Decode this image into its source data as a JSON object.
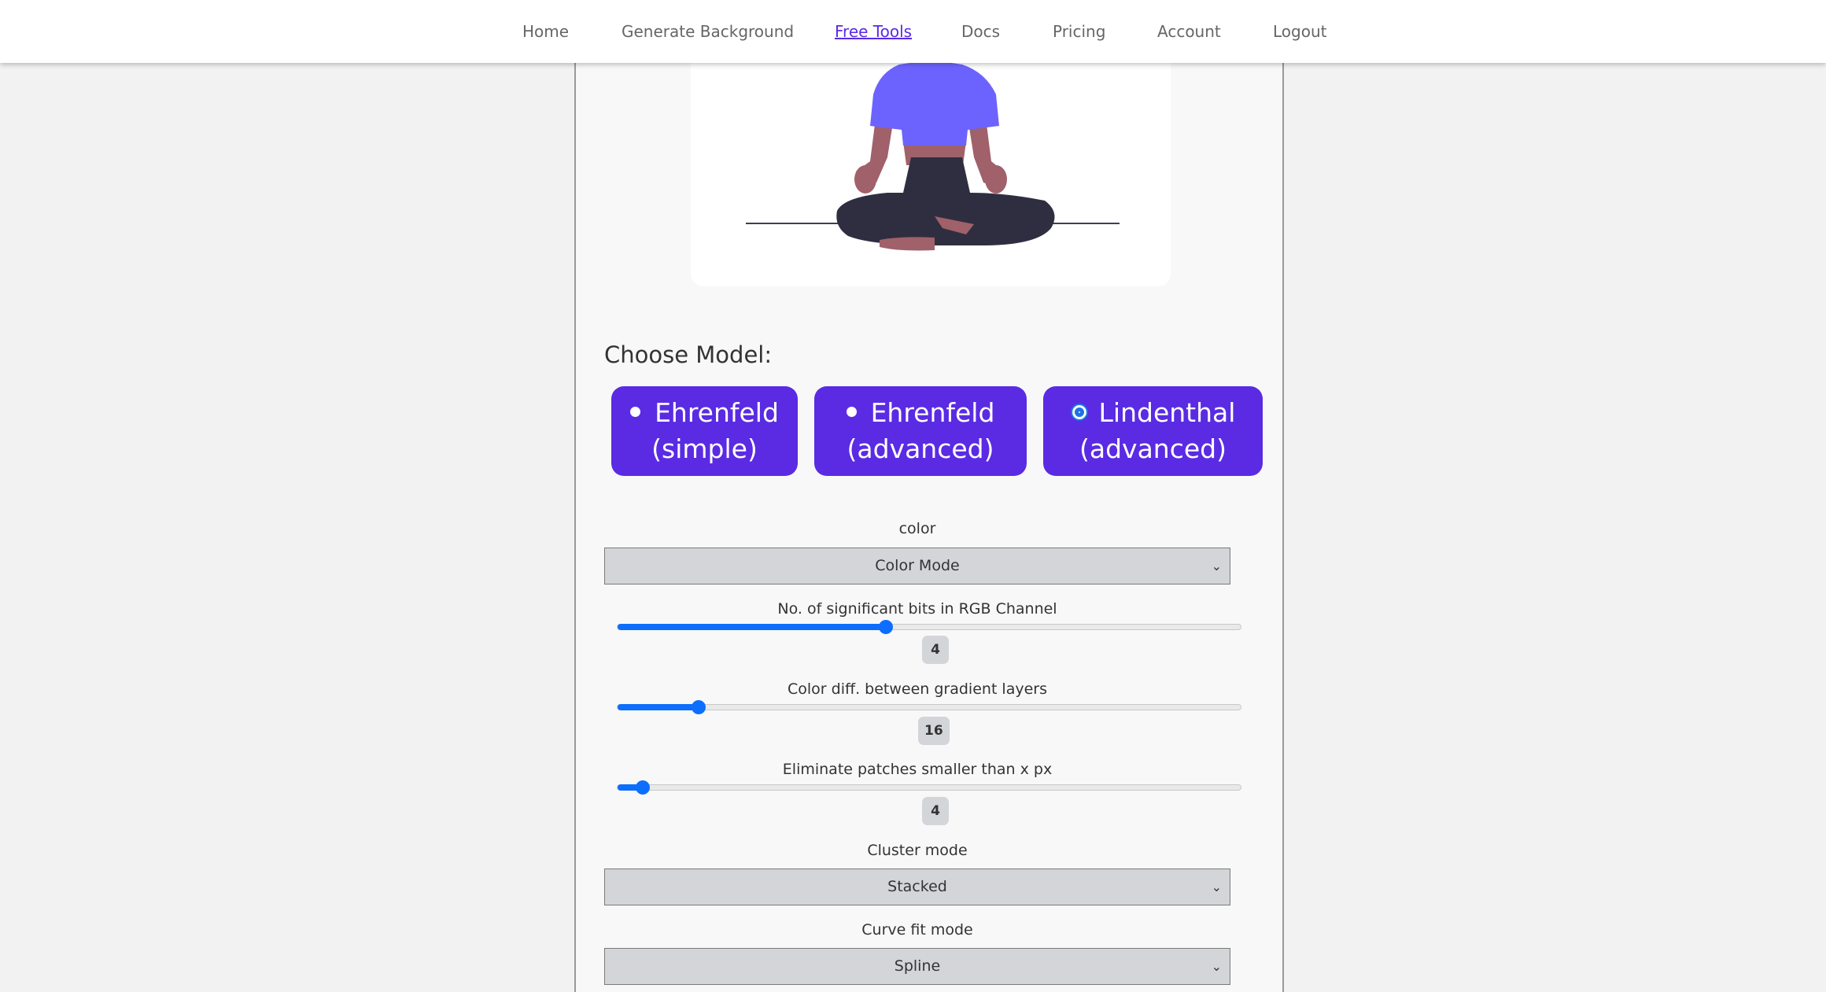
{
  "nav": {
    "items": [
      {
        "label": "Home"
      },
      {
        "label": "Generate Background"
      },
      {
        "label": "Free Tools"
      },
      {
        "label": "Docs"
      },
      {
        "label": "Pricing"
      },
      {
        "label": "Account"
      },
      {
        "label": "Logout"
      }
    ],
    "active_index": 2
  },
  "choose_model": {
    "title": "Choose Model:",
    "options": [
      {
        "line1": "Ehrenfeld",
        "line2": "(simple)",
        "selected": false
      },
      {
        "line1": "Ehrenfeld",
        "line2": "(advanced)",
        "selected": false
      },
      {
        "line1": "Lindenthal",
        "line2": "(advanced)",
        "selected": true
      }
    ]
  },
  "settings": {
    "color": {
      "label": "color",
      "value": "Color Mode"
    },
    "bits": {
      "label": "No. of significant bits in RGB Channel",
      "value": "4",
      "fraction": 0.43
    },
    "color_diff": {
      "label": "Color diff. between gradient layers",
      "value": "16",
      "fraction": 0.13
    },
    "patches": {
      "label": "Eliminate patches smaller than x px",
      "value": "4",
      "fraction": 0.04
    },
    "cluster": {
      "label": "Cluster mode",
      "value": "Stacked"
    },
    "curve": {
      "label": "Curve fit mode",
      "value": "Spline"
    }
  },
  "colors": {
    "accent": "#5a2be3",
    "slider": "#0d6efd",
    "figure_top": "#6c63ff",
    "figure_skin": "#a0616a",
    "figure_pants": "#2f2e41"
  },
  "icons": {
    "select_chevron": "chevron-down-icon"
  }
}
